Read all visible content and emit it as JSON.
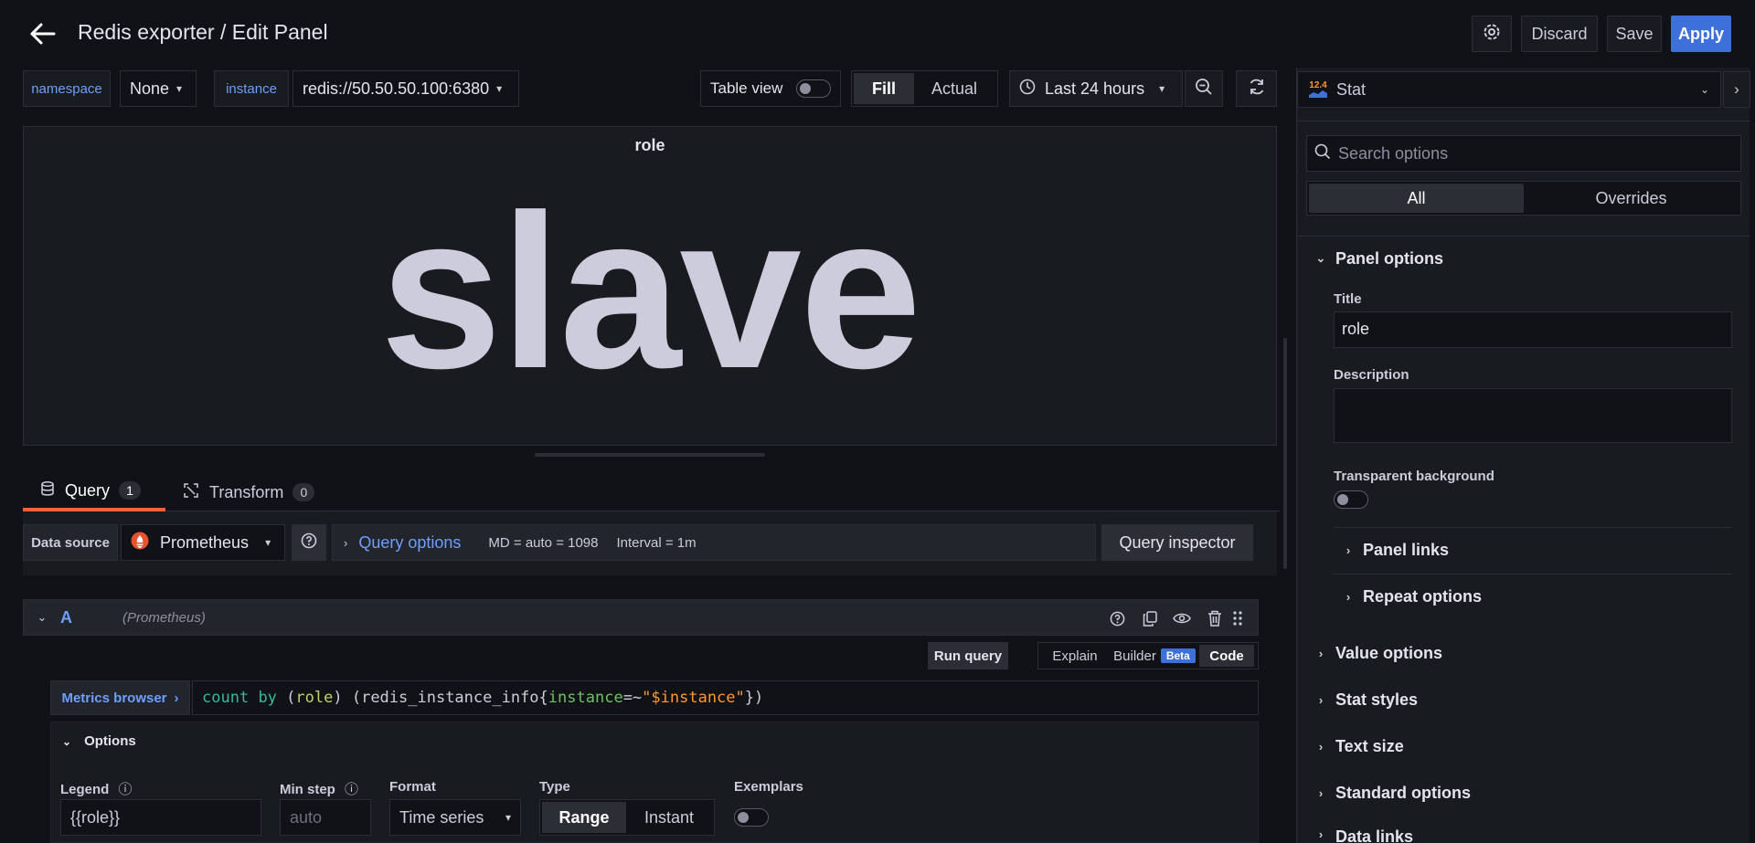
{
  "header": {
    "title": "Redis exporter / Edit Panel",
    "discard_label": "Discard",
    "save_label": "Save",
    "apply_label": "Apply"
  },
  "variables": [
    {
      "label": "namespace",
      "value": "None"
    },
    {
      "label": "instance",
      "value": "redis://50.50.50.100:6380"
    }
  ],
  "toolbar": {
    "table_view_label": "Table view",
    "fill_label": "Fill",
    "actual_label": "Actual",
    "time_range": "Last 24 hours"
  },
  "panel": {
    "title": "role",
    "stat_value": "slave"
  },
  "tabs": [
    {
      "label": "Query",
      "count": "1"
    },
    {
      "label": "Transform",
      "count": "0"
    }
  ],
  "query_row": {
    "datasource_label": "Data source",
    "datasource": "Prometheus",
    "query_options_label": "Query options",
    "md_text": "MD = auto = 1098",
    "interval_text": "Interval = 1m",
    "inspector_label": "Query inspector"
  },
  "query_a": {
    "ref": "A",
    "datasource": "(Prometheus)",
    "run_label": "Run query",
    "explain_label": "Explain",
    "builder_label": "Builder",
    "beta_label": "Beta",
    "code_label": "Code",
    "metrics_browser_label": "Metrics browser",
    "expr_tokens": {
      "fn": "count",
      "by": "by",
      "open1": " (",
      "label": "role",
      "close1": ") (",
      "metric": "redis_instance_info",
      "brace_open": "{",
      "matcher_label": "instance",
      "op": "=~",
      "value": "\"$instance\"",
      "brace_close": "})"
    }
  },
  "options": {
    "title": "Options",
    "legend_label": "Legend",
    "legend_value": "{{role}}",
    "minstep_label": "Min step",
    "minstep_placeholder": "auto",
    "format_label": "Format",
    "format_value": "Time series",
    "type_label": "Type",
    "type_range": "Range",
    "type_instant": "Instant",
    "exemplars_label": "Exemplars"
  },
  "sidepanel": {
    "viz_badge": "12.4",
    "viz_name": "Stat",
    "search_placeholder": "Search options",
    "tab_all": "All",
    "tab_overrides": "Overrides",
    "panel_options": "Panel options",
    "title_label": "Title",
    "title_value": "role",
    "description_label": "Description",
    "transparent_label": "Transparent background",
    "panel_links": "Panel links",
    "repeat_options": "Repeat options",
    "value_options": "Value options",
    "stat_styles": "Stat styles",
    "text_size": "Text size",
    "standard_options": "Standard options",
    "data_links": "Data links"
  },
  "colors": {
    "accent": "#3d71d9",
    "tab_active": "#f55f3e",
    "link": "#6e9fff",
    "prometheus": "#e6522c"
  }
}
